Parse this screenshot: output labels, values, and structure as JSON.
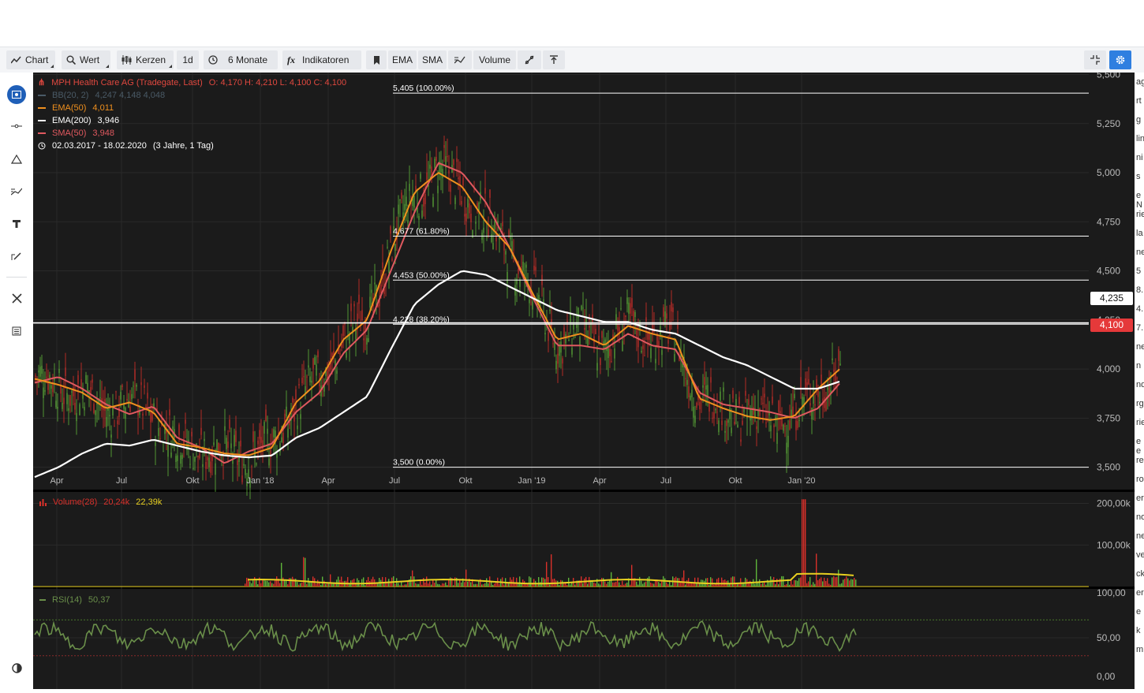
{
  "toolbar": {
    "chart_label": "Chart",
    "wert_label": "Wert",
    "kerzen_label": "Kerzen",
    "interval_label": "1d",
    "period_label": "6 Monate",
    "indicators_label": "Indikatoren",
    "ema_label": "EMA",
    "sma_label": "SMA",
    "volume_label": "Volume"
  },
  "legend": {
    "title": "MPH Health Care AG (Tradegate, Last)",
    "ohlc": "O: 4,170  H: 4,210  L: 4,100  C: 4,100",
    "bb_label": "BB(20, 2)",
    "bb_values": "4,247   4,148   4,048",
    "ema50_label": "EMA(50)",
    "ema50_value": "4,011",
    "ema200_label": "EMA(200)",
    "ema200_value": "3,946",
    "sma50_label": "SMA(50)",
    "sma50_value": "3,948",
    "range": "02.03.2017 - 18.02.2020",
    "range_span": "(3 Jahre, 1 Tag)"
  },
  "volume_panel": {
    "label": "Volume(28)",
    "value1": "20,24k",
    "value2": "22,39k"
  },
  "rsi_panel": {
    "label": "RSI(14)",
    "value": "50,37"
  },
  "price_tags": {
    "crosshair": "4,235",
    "last": "4,100"
  },
  "colors": {
    "background": "#1b1b1b",
    "ema50": "#f0901e",
    "ema200": "#ffffff",
    "sma50": "#e0595f",
    "bb": "#4a5a66",
    "up": "#5fb53a",
    "down": "#d8302a",
    "rsi": "#6a8f4a",
    "volume_avg": "#e8d020",
    "accent": "#2f7fe0"
  },
  "chart_data": [
    {
      "type": "line",
      "title": "MPH Health Care AG (Tradegate, Last)",
      "x_ticks": [
        "Apr",
        "Jul",
        "Okt",
        "Jan '18",
        "Apr",
        "Jul",
        "Okt",
        "Jan '19",
        "Apr",
        "Jul",
        "Okt",
        "Jan '20"
      ],
      "y_ticks": [
        "3,500",
        "3,750",
        "4,000",
        "4,250",
        "4,500",
        "4,750",
        "5,000",
        "5,250",
        "5,500"
      ],
      "ylim": [
        3.39,
        5.51
      ],
      "fibonacci": [
        {
          "label": "5,405 (100.00%)",
          "value": 5.405
        },
        {
          "label": "4,677 (61.80%)",
          "value": 4.677
        },
        {
          "label": "4,453 (50.00%)",
          "value": 4.453
        },
        {
          "label": "4,228 (38.20%)",
          "value": 4.228
        },
        {
          "label": "3,500 (0.00%)",
          "value": 3.5
        }
      ],
      "series": [
        {
          "name": "EMA(50)",
          "values": [
            3.95,
            3.92,
            3.88,
            3.8,
            3.83,
            3.78,
            3.62,
            3.6,
            3.57,
            3.56,
            3.6,
            3.83,
            3.94,
            4.15,
            4.25,
            4.6,
            4.9,
            5.0,
            4.93,
            4.75,
            4.62,
            4.38,
            4.15,
            4.18,
            4.12,
            4.22,
            4.18,
            4.15,
            3.85,
            3.8,
            3.76,
            3.74,
            3.76,
            3.9,
            4.01
          ]
        },
        {
          "name": "EMA(200)",
          "values": [
            3.45,
            3.5,
            3.57,
            3.62,
            3.61,
            3.64,
            3.61,
            3.58,
            3.56,
            3.55,
            3.56,
            3.65,
            3.7,
            3.78,
            3.86,
            4.1,
            4.33,
            4.43,
            4.5,
            4.48,
            4.42,
            4.36,
            4.3,
            4.27,
            4.24,
            4.24,
            4.2,
            4.18,
            4.12,
            4.06,
            4.02,
            3.96,
            3.9,
            3.9,
            3.94
          ]
        },
        {
          "name": "SMA(50)",
          "values": [
            3.93,
            3.96,
            3.9,
            3.82,
            3.77,
            3.81,
            3.65,
            3.6,
            3.52,
            3.58,
            3.62,
            3.78,
            3.88,
            4.08,
            4.2,
            4.5,
            4.8,
            5.05,
            5.0,
            4.85,
            4.62,
            4.36,
            4.12,
            4.12,
            4.1,
            4.18,
            4.12,
            4.1,
            3.88,
            3.82,
            3.8,
            3.78,
            3.75,
            3.8,
            3.94
          ]
        }
      ]
    },
    {
      "type": "bar",
      "title": "Volume(28)",
      "y_ticks": [
        "100,00k",
        "200,00k"
      ],
      "ylim": [
        0,
        220000
      ]
    },
    {
      "type": "line",
      "title": "RSI(14)",
      "y_ticks": [
        "0,00",
        "50,00",
        "100,00"
      ],
      "ylim": [
        0,
        100
      ],
      "levels": [
        30,
        70
      ],
      "last_value": 50.37
    }
  ],
  "right_clip_text": [
    "ag",
    "rt",
    "g",
    "lin",
    "ni",
    "s",
    "e N",
    "rie",
    "la",
    "ne",
    "5",
    "8.",
    "4.",
    "7.",
    "ne",
    "n",
    "nd",
    "rg",
    "rie",
    "e e",
    "rep",
    "ro",
    "er",
    "no",
    "ne",
    "ve",
    "ck",
    "er",
    "e",
    "k",
    "m"
  ]
}
